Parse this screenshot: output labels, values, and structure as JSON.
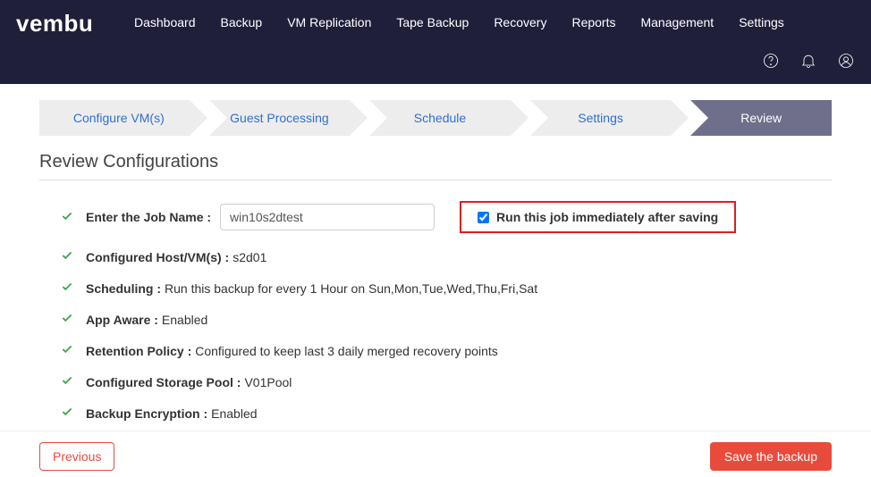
{
  "logo": "vembu",
  "nav": [
    "Dashboard",
    "Backup",
    "VM Replication",
    "Tape Backup",
    "Recovery",
    "Reports",
    "Management",
    "Settings"
  ],
  "wizard": {
    "steps": [
      "Configure VM(s)",
      "Guest Processing",
      "Schedule",
      "Settings",
      "Review"
    ],
    "active_index": 4
  },
  "section_title": "Review Configurations",
  "job_name": {
    "label": "Enter the Job Name :",
    "value": "win10s2dtest"
  },
  "run_immediately": {
    "checked": true,
    "label": "Run this job immediately after saving"
  },
  "rows": [
    {
      "label": "Configured Host/VM(s) :",
      "value": " s2d01"
    },
    {
      "label": "Scheduling :",
      "value": " Run this backup for every 1 Hour on Sun,Mon,Tue,Wed,Thu,Fri,Sat"
    },
    {
      "label": "App Aware :",
      "value": " Enabled"
    },
    {
      "label": "Retention Policy :",
      "value": " Configured to keep last 3 daily merged recovery points"
    },
    {
      "label": "Configured Storage Pool :",
      "value": " V01Pool"
    },
    {
      "label": "Backup Encryption :",
      "value": " Enabled"
    }
  ],
  "buttons": {
    "previous": "Previous",
    "save": "Save the backup"
  }
}
